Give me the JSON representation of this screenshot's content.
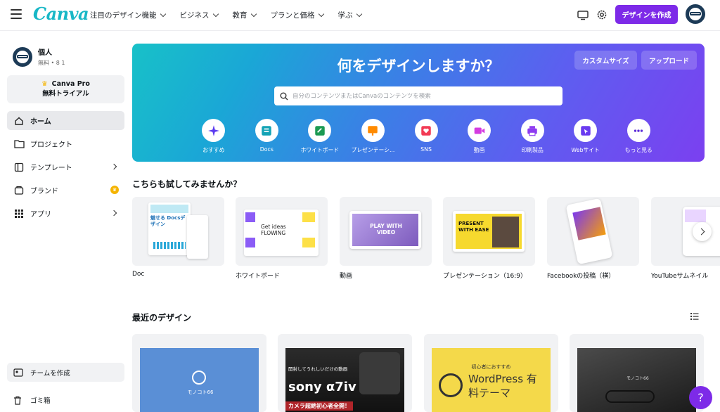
{
  "header": {
    "logo": "Canva",
    "nav": [
      "注目のデザイン機能",
      "ビジネス",
      "教育",
      "プランと価格",
      "学ぶ"
    ],
    "create_button": "デザインを作成"
  },
  "sidebar": {
    "profile_name": "個人",
    "profile_sub": "無料 • 8 1",
    "pro_title": "Canva Pro",
    "pro_sub": "無料トライアル",
    "items": [
      {
        "label": "ホーム",
        "icon": "home-icon"
      },
      {
        "label": "プロジェクト",
        "icon": "folder-icon"
      },
      {
        "label": "テンプレート",
        "icon": "template-icon"
      },
      {
        "label": "ブランド",
        "icon": "brand-icon"
      },
      {
        "label": "アプリ",
        "icon": "apps-grid-icon"
      }
    ],
    "team_button": "チームを作成",
    "trash": "ゴミ箱"
  },
  "hero": {
    "title": "何をデザインしますか？",
    "custom_size": "カスタムサイズ",
    "upload": "アップロード",
    "search_placeholder": "自分のコンテンツまたはCanvaのコンテンツを検索",
    "categories": [
      {
        "label": "おすすめ",
        "icon": "sparkle-icon",
        "color": "#5b3bf0"
      },
      {
        "label": "Docs",
        "icon": "docs-icon",
        "color": "#13a3b5"
      },
      {
        "label": "ホワイトボード",
        "icon": "whiteboard-icon",
        "color": "#1c9a53"
      },
      {
        "label": "プレゼンテーシ...",
        "icon": "presentation-icon",
        "color": "#ff8a00"
      },
      {
        "label": "SNS",
        "icon": "heart-icon",
        "color": "#f23b55"
      },
      {
        "label": "動画",
        "icon": "video-icon",
        "color": "#d43ce0"
      },
      {
        "label": "印刷製品",
        "icon": "print-icon",
        "color": "#8e3bf0"
      },
      {
        "label": "Webサイト",
        "icon": "website-icon",
        "color": "#6a3bf0"
      },
      {
        "label": "もっと見る",
        "icon": "more-icon",
        "color": "#5a2ad8"
      }
    ]
  },
  "try_section": {
    "title": "こちらも試してみませんか？",
    "tiles": [
      {
        "label": "Doc",
        "thumb_text": "魅せる Docsデザイン"
      },
      {
        "label": "ホワイトボード",
        "thumb_text": "Get ideas FLOWING"
      },
      {
        "label": "動画",
        "thumb_text": "PLAY WITH VIDEO"
      },
      {
        "label": "プレゼンテーション（16:9）",
        "thumb_text": "PRESENT WITH EASE"
      },
      {
        "label": "Facebookの投稿（横）",
        "thumb_text": ""
      },
      {
        "label": "YouTubeサムネイル",
        "thumb_text": ""
      }
    ]
  },
  "recent_section": {
    "title": "最近のデザイン",
    "cards": [
      {
        "text": "モノコト66"
      },
      {
        "text": "sony α7iv",
        "sub": "カメラ超絶初心者全開！",
        "top": "開封してうれしいだけの動画"
      },
      {
        "text": "WordPress 有料テーマ",
        "sub": "初心者におすすめ"
      },
      {
        "text": "モノコト66"
      }
    ]
  },
  "help_label": "?"
}
